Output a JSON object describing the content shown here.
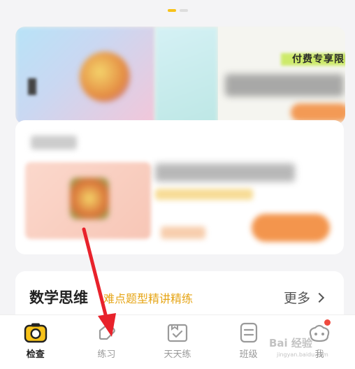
{
  "carousel": {
    "dot_count": 2,
    "active_index": 0
  },
  "banner": {
    "top_text": "付费专享限时"
  },
  "section": {
    "title": "数学思维",
    "subtitle": "难点题型精讲精练",
    "more_label": "更多"
  },
  "tabbar": {
    "items": [
      {
        "key": "check",
        "label": "检查",
        "icon": "camera-icon",
        "active": true
      },
      {
        "key": "practice",
        "label": "练习",
        "icon": "tag-icon",
        "active": false
      },
      {
        "key": "daily",
        "label": "天天练",
        "icon": "calendar-check-icon",
        "active": false
      },
      {
        "key": "class",
        "label": "班级",
        "icon": "class-list-icon",
        "active": false
      },
      {
        "key": "me",
        "label": "我",
        "icon": "mascot-icon",
        "active": false
      }
    ]
  },
  "watermark": {
    "text": "Bai 经验",
    "sub": "jingyan.baidu.com"
  },
  "colors": {
    "accent": "#f7c21a",
    "subtitle": "#e6a516",
    "annotation_arrow": "#e8222b",
    "badge": "#f04a3f"
  }
}
